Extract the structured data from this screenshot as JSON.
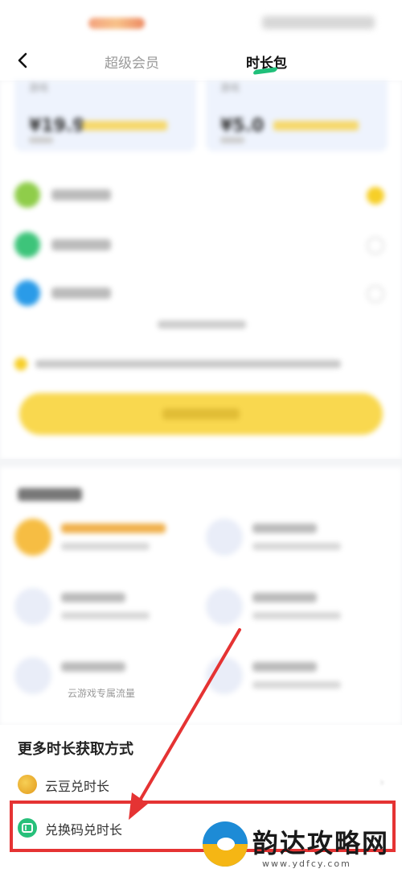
{
  "nav": {
    "tab_inactive": "超级会员",
    "tab_active": "时长包"
  },
  "packs": [
    {
      "game_label": "游戏",
      "price": "¥19.9"
    },
    {
      "game_label": "游戏",
      "price": "¥5.0"
    }
  ],
  "privileges": {
    "flow_label": "云游戏专属流量"
  },
  "more": {
    "title": "更多时长获取方式",
    "options": [
      {
        "label": "云豆兑时长"
      },
      {
        "label": "兑换码兑时长"
      }
    ]
  },
  "watermark": {
    "name": "韵达攻略网",
    "url": "www.ydfcy.com"
  },
  "colors": {
    "accent_yellow": "#f9d84f",
    "active_green": "#1fbf7a",
    "highlight_red": "#e53333"
  }
}
